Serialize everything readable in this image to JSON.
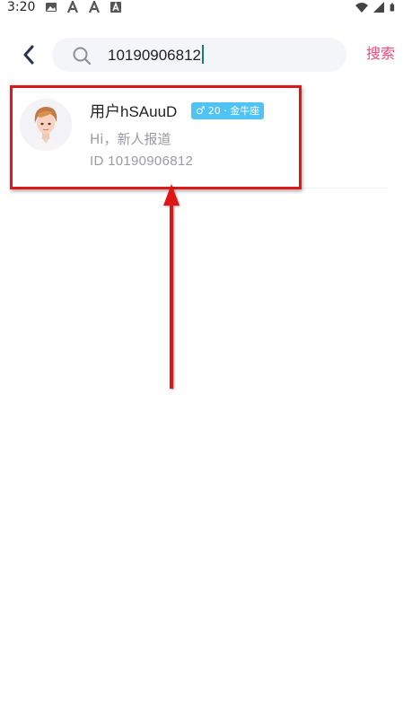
{
  "status_bar": {
    "time": "3:20",
    "left_icons": [
      "image-icon",
      "a-icon",
      "a-icon",
      "a-box-icon"
    ],
    "right_icons": [
      "wifi-icon",
      "signal-icon",
      "battery-icon"
    ]
  },
  "header": {
    "back_icon": "chevron-left-icon",
    "search_icon": "search-icon",
    "search_value": "10190906812",
    "search_label": "搜索"
  },
  "result": {
    "username": "用户hSAuuD",
    "badge": {
      "gender_symbol": "♂",
      "text": "20 · 金牛座"
    },
    "bio": "Hi，新人报道",
    "id_text": "ID 10190906812"
  },
  "colors": {
    "accent_pink": "#ee4a78",
    "badge_blue": "#4ec3f4",
    "annotation_red": "#e01717",
    "cursor_teal": "#12806f"
  }
}
